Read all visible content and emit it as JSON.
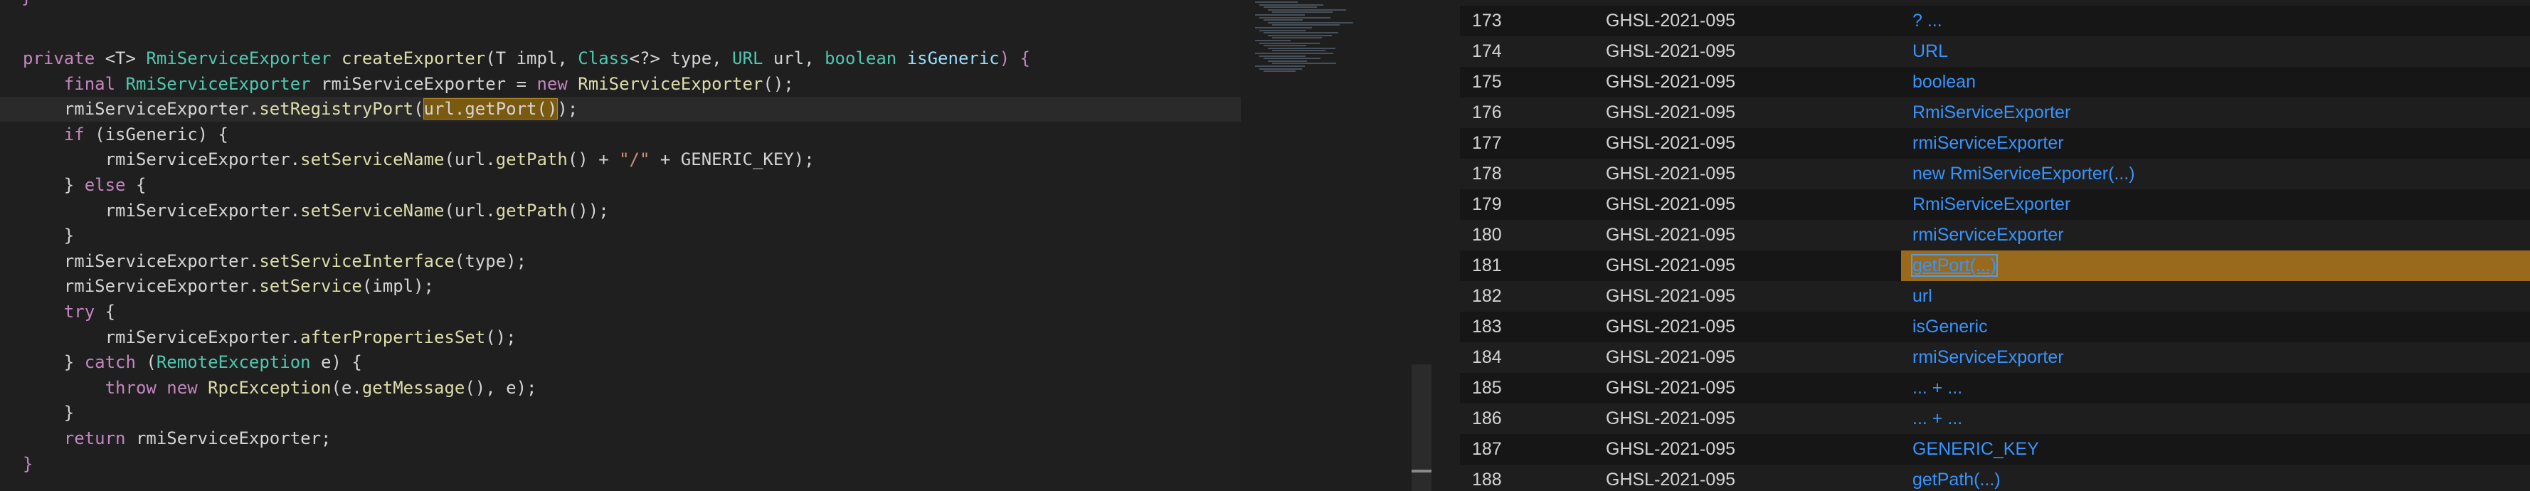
{
  "editor": {
    "top_brace": "}",
    "lines": [
      [
        {
          "t": "private ",
          "c": "kw"
        },
        {
          "t": "<T> ",
          "c": "var"
        },
        {
          "t": "RmiServiceExporter ",
          "c": "type"
        },
        {
          "t": "createExporter",
          "c": "fn"
        },
        {
          "t": "(T ",
          "c": "var"
        },
        {
          "t": "impl",
          "c": "var"
        },
        {
          "t": ", ",
          "c": "var"
        },
        {
          "t": "Class",
          "c": "type"
        },
        {
          "t": "<?> ",
          "c": "var"
        },
        {
          "t": "type",
          "c": "var"
        },
        {
          "t": ", ",
          "c": "var"
        },
        {
          "t": "URL ",
          "c": "type"
        },
        {
          "t": "url",
          "c": "var"
        },
        {
          "t": ", ",
          "c": "var"
        },
        {
          "t": "boolean ",
          "c": "type"
        },
        {
          "t": "isGeneric",
          "c": "param"
        },
        {
          "t": ") {",
          "c": "kw"
        }
      ],
      [
        {
          "t": "    final ",
          "c": "kw"
        },
        {
          "t": "RmiServiceExporter ",
          "c": "type"
        },
        {
          "t": "rmiServiceExporter = ",
          "c": "var"
        },
        {
          "t": "new ",
          "c": "kw"
        },
        {
          "t": "RmiServiceExporter",
          "c": "fn"
        },
        {
          "t": "();",
          "c": "var"
        }
      ],
      [
        {
          "t": "    rmiServiceExporter.",
          "c": "var"
        },
        {
          "t": "setRegistryPort",
          "c": "fn"
        },
        {
          "t": "(",
          "c": "var"
        },
        {
          "t": "url.getPort()",
          "c": "hl"
        },
        {
          "t": ");",
          "c": "var"
        }
      ],
      [
        {
          "t": "    if ",
          "c": "kw"
        },
        {
          "t": "(isGeneric) {",
          "c": "var"
        }
      ],
      [
        {
          "t": "        rmiServiceExporter.",
          "c": "var"
        },
        {
          "t": "setServiceName",
          "c": "fn"
        },
        {
          "t": "(url.",
          "c": "var"
        },
        {
          "t": "getPath",
          "c": "fn"
        },
        {
          "t": "() + ",
          "c": "var"
        },
        {
          "t": "\"/\"",
          "c": "str"
        },
        {
          "t": " + GENERIC_KEY);",
          "c": "var"
        }
      ],
      [
        {
          "t": "    } ",
          "c": "var"
        },
        {
          "t": "else ",
          "c": "kw"
        },
        {
          "t": "{",
          "c": "var"
        }
      ],
      [
        {
          "t": "        rmiServiceExporter.",
          "c": "var"
        },
        {
          "t": "setServiceName",
          "c": "fn"
        },
        {
          "t": "(url.",
          "c": "var"
        },
        {
          "t": "getPath",
          "c": "fn"
        },
        {
          "t": "());",
          "c": "var"
        }
      ],
      [
        {
          "t": "    }",
          "c": "var"
        }
      ],
      [
        {
          "t": "    rmiServiceExporter.",
          "c": "var"
        },
        {
          "t": "setServiceInterface",
          "c": "fn"
        },
        {
          "t": "(type);",
          "c": "var"
        }
      ],
      [
        {
          "t": "    rmiServiceExporter.",
          "c": "var"
        },
        {
          "t": "setService",
          "c": "fn"
        },
        {
          "t": "(impl);",
          "c": "var"
        }
      ],
      [
        {
          "t": "    try ",
          "c": "kw"
        },
        {
          "t": "{",
          "c": "var"
        }
      ],
      [
        {
          "t": "        rmiServiceExporter.",
          "c": "var"
        },
        {
          "t": "afterPropertiesSet",
          "c": "fn"
        },
        {
          "t": "();",
          "c": "var"
        }
      ],
      [
        {
          "t": "    } ",
          "c": "var"
        },
        {
          "t": "catch ",
          "c": "kw"
        },
        {
          "t": "(",
          "c": "var"
        },
        {
          "t": "RemoteException ",
          "c": "type"
        },
        {
          "t": "e) {",
          "c": "var"
        }
      ],
      [
        {
          "t": "        throw new ",
          "c": "kw"
        },
        {
          "t": "RpcException",
          "c": "fn"
        },
        {
          "t": "(e.",
          "c": "var"
        },
        {
          "t": "getMessage",
          "c": "fn"
        },
        {
          "t": "(), e);",
          "c": "var"
        }
      ],
      [
        {
          "t": "    }",
          "c": "var"
        }
      ],
      [
        {
          "t": "    return ",
          "c": "kw"
        },
        {
          "t": "rmiServiceExporter;",
          "c": "var"
        }
      ],
      [
        {
          "t": "}",
          "c": "kw"
        }
      ]
    ],
    "current_line_index": 2
  },
  "results": {
    "rows": [
      {
        "num": "173",
        "id": "GHSL-2021-095",
        "node": "? ..."
      },
      {
        "num": "174",
        "id": "GHSL-2021-095",
        "node": "URL"
      },
      {
        "num": "175",
        "id": "GHSL-2021-095",
        "node": "boolean"
      },
      {
        "num": "176",
        "id": "GHSL-2021-095",
        "node": "RmiServiceExporter"
      },
      {
        "num": "177",
        "id": "GHSL-2021-095",
        "node": "rmiServiceExporter"
      },
      {
        "num": "178",
        "id": "GHSL-2021-095",
        "node": "new RmiServiceExporter(...)"
      },
      {
        "num": "179",
        "id": "GHSL-2021-095",
        "node": "RmiServiceExporter"
      },
      {
        "num": "180",
        "id": "GHSL-2021-095",
        "node": "rmiServiceExporter"
      },
      {
        "num": "181",
        "id": "GHSL-2021-095",
        "node": "getPort(...)",
        "selected": true
      },
      {
        "num": "182",
        "id": "GHSL-2021-095",
        "node": "url"
      },
      {
        "num": "183",
        "id": "GHSL-2021-095",
        "node": "isGeneric"
      },
      {
        "num": "184",
        "id": "GHSL-2021-095",
        "node": "rmiServiceExporter"
      },
      {
        "num": "185",
        "id": "GHSL-2021-095",
        "node": "... + ..."
      },
      {
        "num": "186",
        "id": "GHSL-2021-095",
        "node": "... + ..."
      },
      {
        "num": "187",
        "id": "GHSL-2021-095",
        "node": "GENERIC_KEY"
      },
      {
        "num": "188",
        "id": "GHSL-2021-095",
        "node": "getPath(...)"
      }
    ]
  },
  "colors": {
    "editor_bg": "#1f1f1f",
    "keyword": "#c586c0",
    "type": "#4ec9b0",
    "function": "#dcdcaa",
    "string": "#ce9178",
    "link": "#3794ff",
    "selected_row": "#9a6a1c"
  }
}
